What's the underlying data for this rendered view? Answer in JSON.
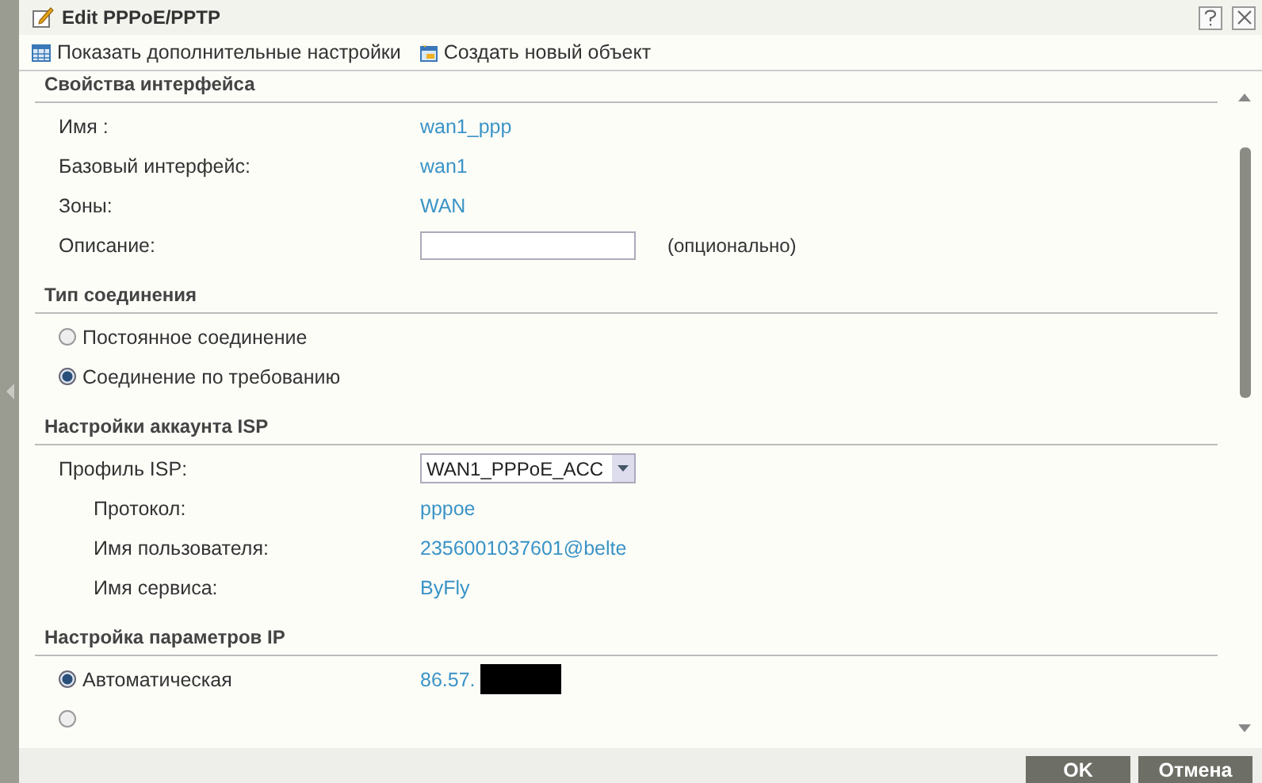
{
  "window": {
    "title": "Edit PPPoE/PPTP"
  },
  "toolbar": [
    {
      "label": "Показать дополнительные настройки",
      "kind": "table"
    },
    {
      "label": "Создать новый объект",
      "kind": "create"
    }
  ],
  "sections": [
    {
      "heading": "Свойства интерфейса",
      "rows": [
        {
          "kind": "value",
          "label": "Имя :",
          "value": "wan1_ppp"
        },
        {
          "kind": "value",
          "label": "Базовый интерфейс:",
          "value": "wan1"
        },
        {
          "kind": "value",
          "label": "Зоны:",
          "value": "WAN"
        },
        {
          "kind": "input",
          "label": "Описание:",
          "note": "(опционально)"
        }
      ]
    },
    {
      "heading": "Тип соединения",
      "rows": [
        {
          "kind": "radio",
          "label": "Постоянное соединение",
          "selected": false
        },
        {
          "kind": "radio",
          "label": "Соединение по требованию",
          "selected": true
        }
      ]
    },
    {
      "heading": "Настройки аккаунта ISP",
      "rows": [
        {
          "kind": "select",
          "label": "Профиль ISP:",
          "value": "WAN1_PPPoE_ACC"
        },
        {
          "kind": "subvalue",
          "label": "Протокол:",
          "value": "pppoe"
        },
        {
          "kind": "subvalue",
          "label": "Имя пользователя:",
          "value": "2356001037601@belte"
        },
        {
          "kind": "subvalue",
          "label": "Имя сервиса:",
          "value": "ByFly"
        }
      ]
    },
    {
      "heading": "Настройка параметров IP",
      "rows": [
        {
          "kind": "radio",
          "label": "Автоматическая",
          "selected": true,
          "value": "86.57.",
          "redacted": true
        },
        {
          "kind": "radio",
          "selected": false
        }
      ]
    }
  ],
  "buttons": [
    {
      "label": "OK"
    },
    {
      "label": "Отмена"
    }
  ]
}
